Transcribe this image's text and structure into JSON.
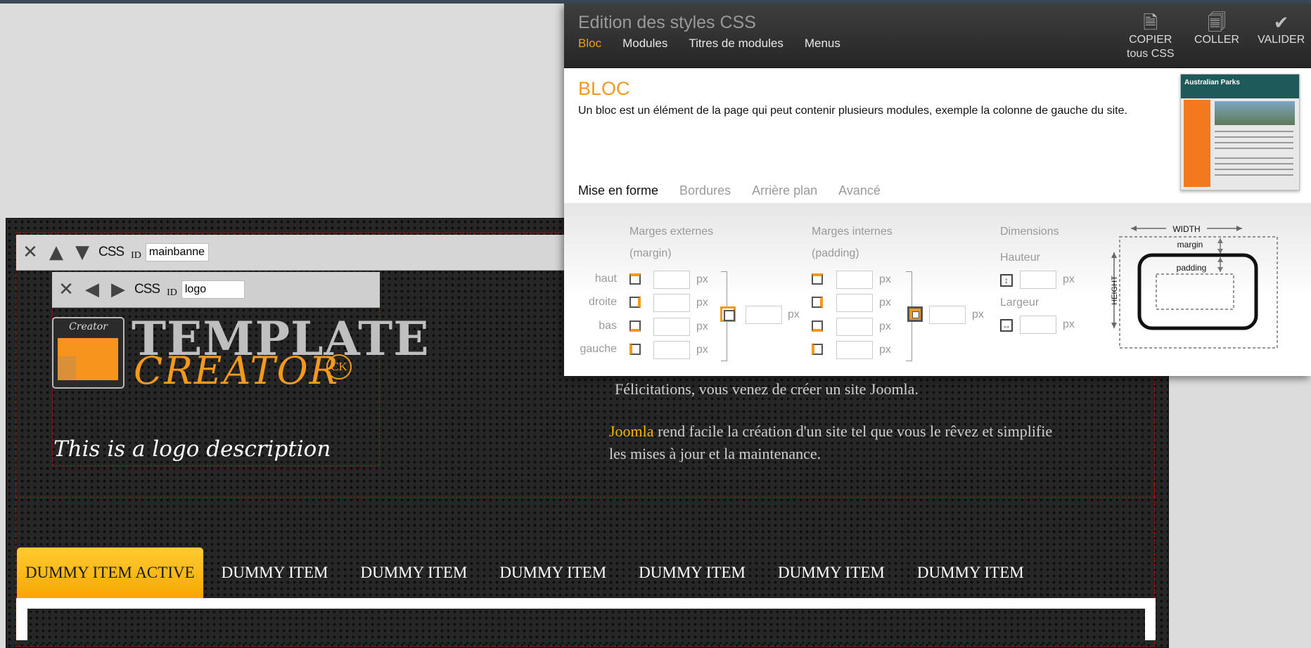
{
  "site": {
    "banner_toolbar": {
      "css_label": "CSS",
      "id_label": "ID",
      "id_value": "mainbanner"
    },
    "logo_toolbar": {
      "css_label": "CSS",
      "id_label": "ID",
      "id_value": "logo"
    },
    "logo": {
      "badge_text": "Creator",
      "word1": "TEMPLATE",
      "word2": "CREATOR",
      "ck": "CK",
      "description": "This is a logo description"
    },
    "welcome": {
      "line1": "Félicitations, vous venez de créer un site Joomla.",
      "line2_highlight": "Joomla",
      "line2_rest": " rend facile la création d'un site tel que vous le rêvez et simplifie les mises à jour et la maintenance."
    },
    "menu": {
      "active": "DUMMY ITEM ACTIVE",
      "items": [
        "DUMMY ITEM",
        "DUMMY ITEM",
        "DUMMY ITEM",
        "DUMMY ITEM",
        "DUMMY ITEM",
        "DUMMY ITEM"
      ]
    }
  },
  "panel": {
    "title": "Edition des styles CSS",
    "tabs": [
      "Bloc",
      "Modules",
      "Titres de modules",
      "Menus"
    ],
    "actions": {
      "copy_line1": "COPIER",
      "copy_line2": "tous CSS",
      "paste": "COLLER",
      "validate": "VALIDER"
    },
    "section_title": "BLOC",
    "section_desc": "Un bloc est un élément de la page qui peut contenir plusieurs modules, exemple la colonne de gauche du site.",
    "preview": {
      "site_title": "Australian Parks"
    },
    "subtabs": [
      "Mise en forme",
      "Bordures",
      "Arrière plan",
      "Avancé"
    ],
    "form": {
      "margin_title": "Marges externes",
      "margin_sub": "(margin)",
      "padding_title": "Marges internes",
      "padding_sub": "(padding)",
      "dimensions_title": "Dimensions",
      "height_label": "Hauteur",
      "width_label": "Largeur",
      "sides": [
        "haut",
        "droite",
        "bas",
        "gauche"
      ],
      "unit": "px"
    },
    "diagram": {
      "width": "WIDTH",
      "height": "HEIGHT",
      "margin": "margin",
      "padding": "padding"
    }
  },
  "colors": {
    "accent": "#f39a1e",
    "menu_active": "#ffc21f",
    "header": "#2e2e2e"
  }
}
